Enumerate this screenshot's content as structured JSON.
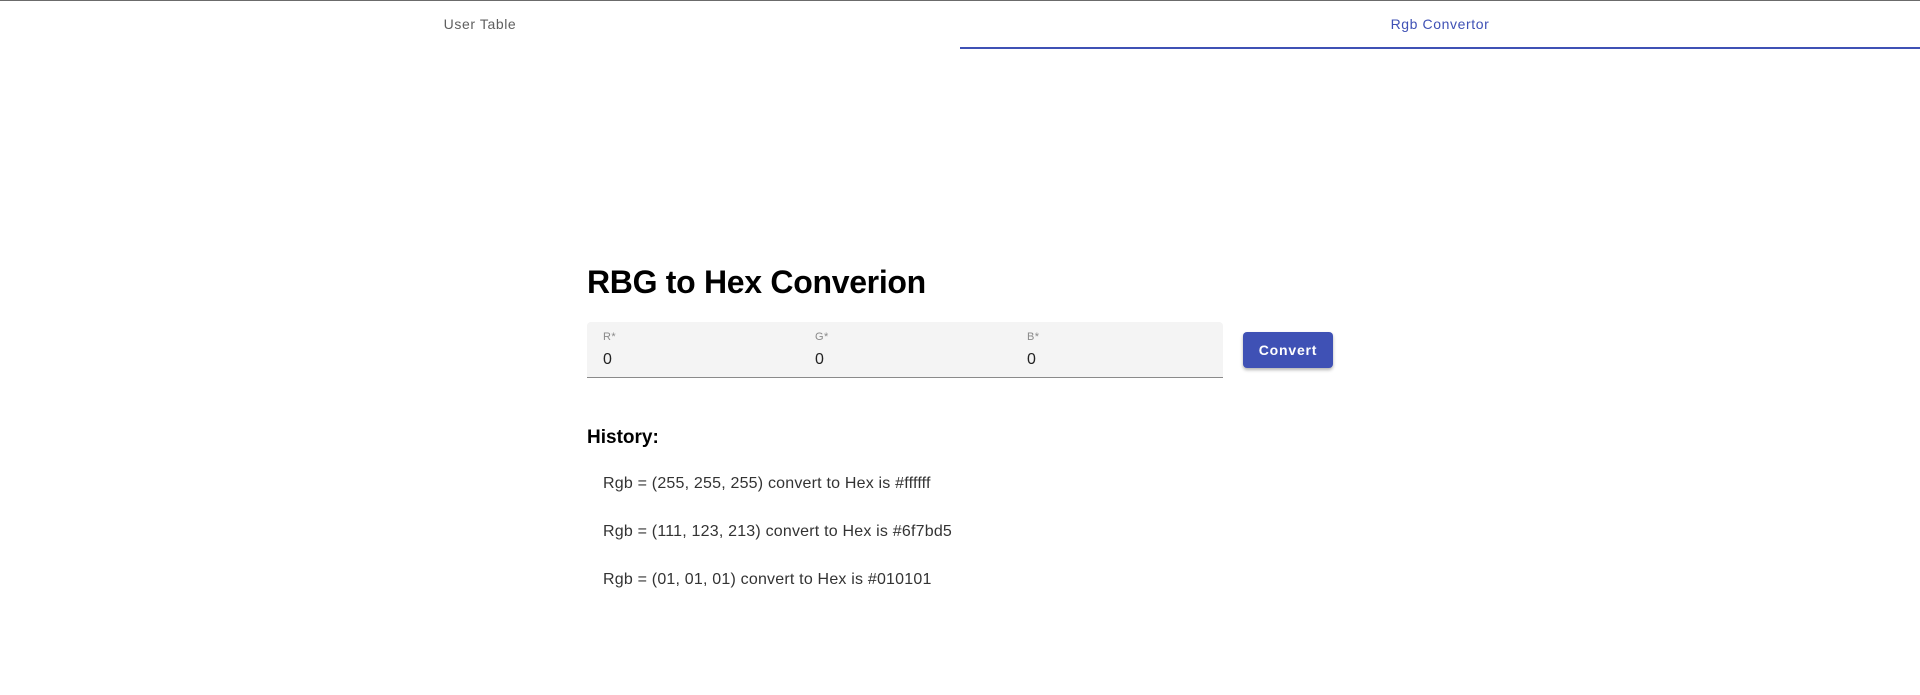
{
  "tabs": [
    {
      "label": "User Table",
      "active": false
    },
    {
      "label": "Rgb Convertor",
      "active": true
    }
  ],
  "accent_color": "#3f51b5",
  "converter": {
    "title": "RBG to Hex Converion",
    "fields": {
      "r": {
        "label": "R*",
        "value": "0"
      },
      "g": {
        "label": "G*",
        "value": "0"
      },
      "b": {
        "label": "B*",
        "value": "0"
      }
    },
    "convert_label": "Convert"
  },
  "history": {
    "title": "History:",
    "items": [
      "Rgb = (255, 255, 255) convert to Hex is #ffffff",
      "Rgb = (111, 123, 213) convert to Hex is #6f7bd5",
      "Rgb = (01, 01, 01) convert to Hex is #010101"
    ]
  }
}
